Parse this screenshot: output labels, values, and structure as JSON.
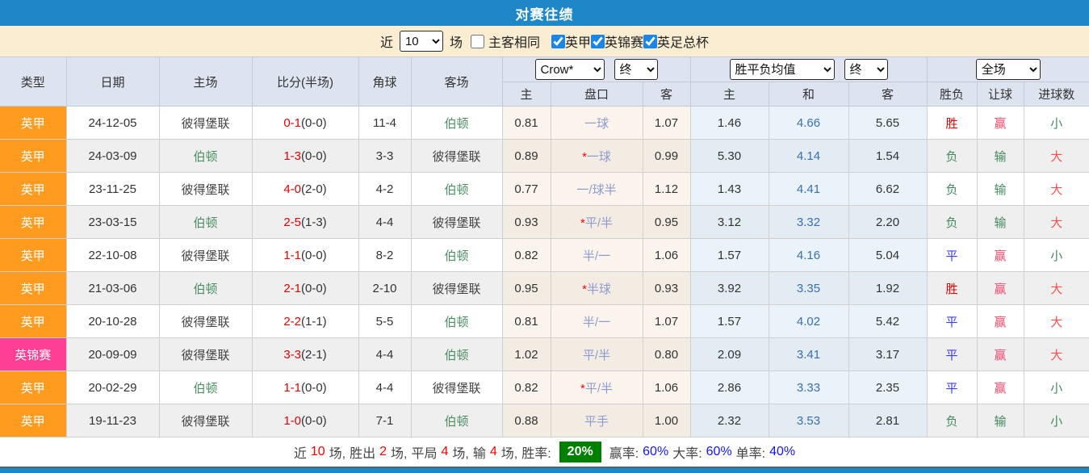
{
  "title": "对赛往绩",
  "filter": {
    "near_label": "近",
    "recent_count": "10",
    "games_label": "场",
    "same_venue_label": "主客相同",
    "same_venue_checked": false,
    "leagues": [
      {
        "label": "英甲",
        "checked": true
      },
      {
        "label": "英锦赛",
        "checked": true
      },
      {
        "label": "英足总杯",
        "checked": true
      }
    ]
  },
  "table": {
    "main_headers": {
      "type": "类型",
      "date": "日期",
      "home": "主场",
      "score": "比分(半场)",
      "corners": "角球",
      "away": "客场"
    },
    "selects": {
      "odds_company": "Crow*",
      "odds_stage": "终",
      "mean_type": "胜平负均值",
      "mean_stage": "终",
      "scope": "全场"
    },
    "sub_headers": {
      "odds_home": "主",
      "handicap": "盘口",
      "odds_away": "客",
      "mean_home": "主",
      "mean_draw": "和",
      "mean_away": "客",
      "result": "胜负",
      "handicap_result": "让球",
      "goals": "进球数"
    },
    "rows": [
      {
        "type": "英甲",
        "type_cls": "type-league1",
        "date": "24-12-05",
        "home": "彼得堡联",
        "home_cls": "team-dark",
        "score": "0-1",
        "half": "(0-0)",
        "corners": "11-4",
        "away": "伯顿",
        "away_cls": "team-green",
        "odds_home": "0.81",
        "star": "",
        "handicap": "一球",
        "odds_away": "1.07",
        "mean_home": "1.46",
        "mean_draw": "4.66",
        "mean_away": "5.65",
        "result": "胜",
        "result_cls": "res-win",
        "hresult": "赢",
        "hresult_cls": "let-win",
        "goals": "小",
        "goals_cls": "goal-small"
      },
      {
        "type": "英甲",
        "type_cls": "type-league1",
        "date": "24-03-09",
        "home": "伯顿",
        "home_cls": "team-green",
        "score": "1-3",
        "half": "(0-0)",
        "corners": "3-3",
        "away": "彼得堡联",
        "away_cls": "team-dark",
        "odds_home": "0.89",
        "star": "*",
        "handicap": "一球",
        "odds_away": "0.99",
        "mean_home": "5.30",
        "mean_draw": "4.14",
        "mean_away": "1.54",
        "result": "负",
        "result_cls": "res-lose",
        "hresult": "输",
        "hresult_cls": "let-lose",
        "goals": "大",
        "goals_cls": "goal-big"
      },
      {
        "type": "英甲",
        "type_cls": "type-league1",
        "date": "23-11-25",
        "home": "彼得堡联",
        "home_cls": "team-dark",
        "score": "4-0",
        "half": "(2-0)",
        "corners": "4-2",
        "away": "伯顿",
        "away_cls": "team-green",
        "odds_home": "0.77",
        "star": "",
        "handicap": "一/球半",
        "odds_away": "1.12",
        "mean_home": "1.43",
        "mean_draw": "4.41",
        "mean_away": "6.62",
        "result": "负",
        "result_cls": "res-lose",
        "hresult": "输",
        "hresult_cls": "let-lose",
        "goals": "大",
        "goals_cls": "goal-big"
      },
      {
        "type": "英甲",
        "type_cls": "type-league1",
        "date": "23-03-15",
        "home": "伯顿",
        "home_cls": "team-green",
        "score": "2-5",
        "half": "(1-3)",
        "corners": "4-4",
        "away": "彼得堡联",
        "away_cls": "team-dark",
        "odds_home": "0.93",
        "star": "*",
        "handicap": "平/半",
        "odds_away": "0.95",
        "mean_home": "3.12",
        "mean_draw": "3.32",
        "mean_away": "2.20",
        "result": "负",
        "result_cls": "res-lose",
        "hresult": "输",
        "hresult_cls": "let-lose",
        "goals": "大",
        "goals_cls": "goal-big"
      },
      {
        "type": "英甲",
        "type_cls": "type-league1",
        "date": "22-10-08",
        "home": "彼得堡联",
        "home_cls": "team-dark",
        "score": "1-1",
        "half": "(0-0)",
        "corners": "8-2",
        "away": "伯顿",
        "away_cls": "team-green",
        "odds_home": "0.82",
        "star": "",
        "handicap": "半/一",
        "odds_away": "1.06",
        "mean_home": "1.57",
        "mean_draw": "4.16",
        "mean_away": "5.04",
        "result": "平",
        "result_cls": "res-draw",
        "hresult": "赢",
        "hresult_cls": "let-win",
        "goals": "小",
        "goals_cls": "goal-small"
      },
      {
        "type": "英甲",
        "type_cls": "type-league1",
        "date": "21-03-06",
        "home": "伯顿",
        "home_cls": "team-green",
        "score": "2-1",
        "half": "(0-0)",
        "corners": "2-10",
        "away": "彼得堡联",
        "away_cls": "team-dark",
        "odds_home": "0.95",
        "star": "*",
        "handicap": "半球",
        "odds_away": "0.93",
        "mean_home": "3.92",
        "mean_draw": "3.35",
        "mean_away": "1.92",
        "result": "胜",
        "result_cls": "res-win",
        "hresult": "赢",
        "hresult_cls": "let-win",
        "goals": "大",
        "goals_cls": "goal-big"
      },
      {
        "type": "英甲",
        "type_cls": "type-league1",
        "date": "20-10-28",
        "home": "彼得堡联",
        "home_cls": "team-dark",
        "score": "2-2",
        "half": "(1-1)",
        "corners": "5-5",
        "away": "伯顿",
        "away_cls": "team-green",
        "odds_home": "0.81",
        "star": "",
        "handicap": "半/一",
        "odds_away": "1.07",
        "mean_home": "1.57",
        "mean_draw": "4.02",
        "mean_away": "5.42",
        "result": "平",
        "result_cls": "res-draw",
        "hresult": "赢",
        "hresult_cls": "let-win",
        "goals": "大",
        "goals_cls": "goal-big"
      },
      {
        "type": "英锦赛",
        "type_cls": "type-trophy",
        "date": "20-09-09",
        "home": "彼得堡联",
        "home_cls": "team-dark",
        "score": "3-3",
        "half": "(2-1)",
        "corners": "4-4",
        "away": "伯顿",
        "away_cls": "team-green",
        "odds_home": "1.02",
        "star": "",
        "handicap": "平/半",
        "odds_away": "0.80",
        "mean_home": "2.09",
        "mean_draw": "3.41",
        "mean_away": "3.17",
        "result": "平",
        "result_cls": "res-draw",
        "hresult": "赢",
        "hresult_cls": "let-win",
        "goals": "大",
        "goals_cls": "goal-big"
      },
      {
        "type": "英甲",
        "type_cls": "type-league1",
        "date": "20-02-29",
        "home": "伯顿",
        "home_cls": "team-green",
        "score": "1-1",
        "half": "(0-0)",
        "corners": "4-4",
        "away": "彼得堡联",
        "away_cls": "team-dark",
        "odds_home": "0.82",
        "star": "*",
        "handicap": "平/半",
        "odds_away": "1.06",
        "mean_home": "2.86",
        "mean_draw": "3.33",
        "mean_away": "2.35",
        "result": "平",
        "result_cls": "res-draw",
        "hresult": "赢",
        "hresult_cls": "let-win",
        "goals": "小",
        "goals_cls": "goal-small"
      },
      {
        "type": "英甲",
        "type_cls": "type-league1",
        "date": "19-11-23",
        "home": "彼得堡联",
        "home_cls": "team-dark",
        "score": "1-0",
        "half": "(0-0)",
        "corners": "7-1",
        "away": "伯顿",
        "away_cls": "team-green",
        "odds_home": "0.88",
        "star": "",
        "handicap": "平手",
        "odds_away": "1.00",
        "mean_home": "2.32",
        "mean_draw": "3.53",
        "mean_away": "2.81",
        "result": "负",
        "result_cls": "res-lose",
        "hresult": "输",
        "hresult_cls": "let-lose",
        "goals": "小",
        "goals_cls": "goal-small"
      }
    ]
  },
  "summary": {
    "recent_label": "近",
    "recent_value": "10",
    "recent_suffix": "场,",
    "win_label": "胜出",
    "win_value": "2",
    "win_suffix": "场,",
    "draw_label": "平局",
    "draw_value": "4",
    "draw_suffix": "场,",
    "lose_label": "输",
    "lose_value": "4",
    "lose_suffix": "场,",
    "winrate_label": "胜率:",
    "winrate_value": "20%",
    "handicap_rate_label": "赢率:",
    "handicap_rate_value": "60%",
    "big_rate_label": "大率:",
    "big_rate_value": "60%",
    "single_rate_label": "单率:",
    "single_rate_value": "40%"
  },
  "colors": {
    "accent_blue": "#1d87c8",
    "league1_orange": "#ff9c20",
    "trophy_pink": "#ff3f96",
    "win_red": "#e60000",
    "draw_blue": "#3b3bf0",
    "lose_green": "#44895f",
    "handicap_win_pink": "#fb4a6e",
    "big_red": "#ff5050",
    "badge_green": "#008000",
    "filter_bg": "#faedd2",
    "header_bg": "#dde4ef"
  }
}
